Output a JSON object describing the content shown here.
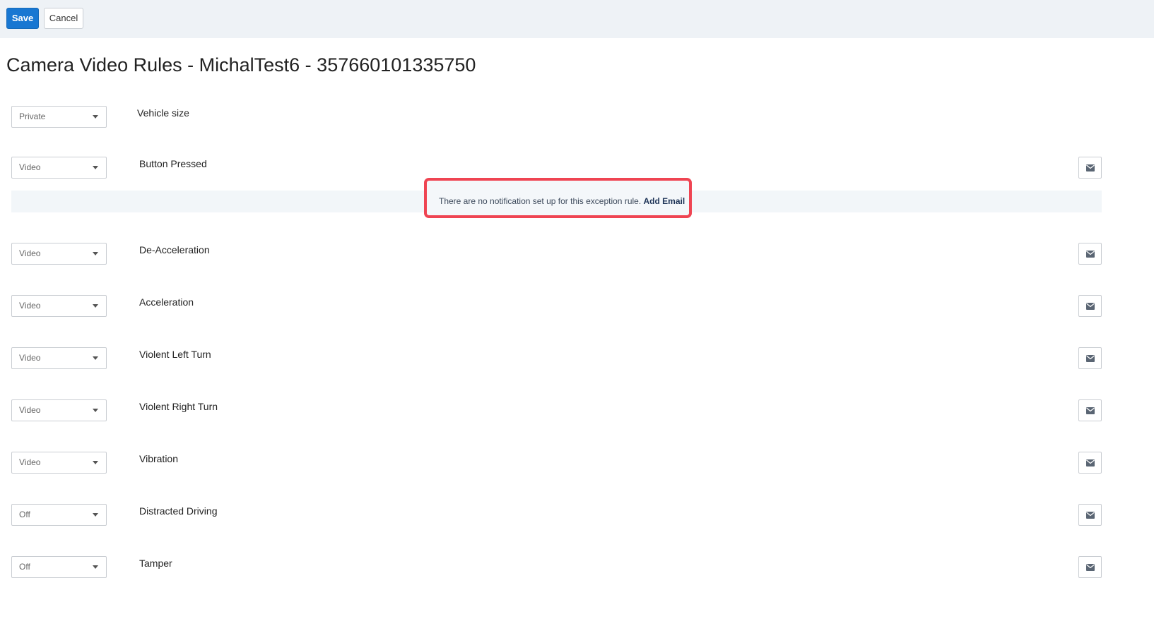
{
  "toolbar": {
    "save_label": "Save",
    "cancel_label": "Cancel"
  },
  "page": {
    "title": "Camera Video Rules - MichalTest6 - 357660101335750"
  },
  "rules": [
    {
      "mode": "Private",
      "label": "Vehicle size"
    },
    {
      "mode": "Video",
      "label": "Button Pressed"
    },
    {
      "mode": "Video",
      "label": "De-Acceleration"
    },
    {
      "mode": "Video",
      "label": "Acceleration"
    },
    {
      "mode": "Video",
      "label": "Violent Left Turn"
    },
    {
      "mode": "Video",
      "label": "Violent Right Turn"
    },
    {
      "mode": "Video",
      "label": "Vibration"
    },
    {
      "mode": "Off",
      "label": "Distracted Driving"
    },
    {
      "mode": "Off",
      "label": "Tamper"
    }
  ],
  "notification": {
    "message": "There are no notification set up for this exception rule.",
    "link_label": "Add Email"
  },
  "icons": {
    "email": "envelope-icon",
    "dropdown": "caret-down-icon"
  },
  "colors": {
    "primary": "#1877d2",
    "highlight": "#ef4452",
    "toolbar_bg": "#eef2f6",
    "notification_bg": "#f2f6f9"
  }
}
